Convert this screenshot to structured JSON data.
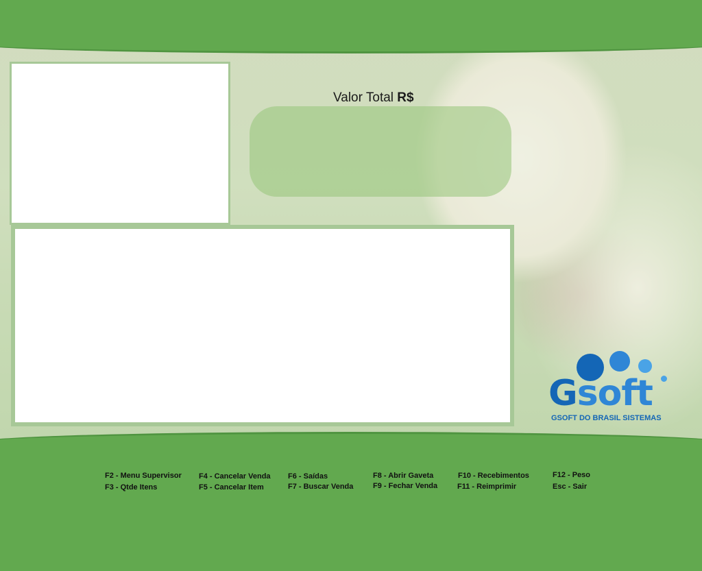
{
  "total": {
    "label": "Valor Total",
    "currency": "R$",
    "value": ""
  },
  "logo": {
    "brand_g": "G",
    "brand_soft": "soft",
    "tagline": "GSOFT DO BRASIL SISTEMAS"
  },
  "shortcuts": [
    {
      "label": "F2 - Menu Supervisor"
    },
    {
      "label": "F3 - Qtde Itens"
    },
    {
      "label": "F4 - Cancelar Venda"
    },
    {
      "label": "F5 - Cancelar Item"
    },
    {
      "label": "F6 - Saídas"
    },
    {
      "label": "F7 - Buscar Venda"
    },
    {
      "label": "F8 - Abrir Gaveta"
    },
    {
      "label": "F9 - Fechar Venda"
    },
    {
      "label": "F10 - Recebimentos"
    },
    {
      "label": "F11 - Reimprimir"
    },
    {
      "label": "F12 - Peso"
    },
    {
      "label": "Esc - Sair"
    }
  ],
  "colors": {
    "bar_green": "#62a94f",
    "panel_border": "#a7c897",
    "logo_blue": "#1466b6"
  }
}
